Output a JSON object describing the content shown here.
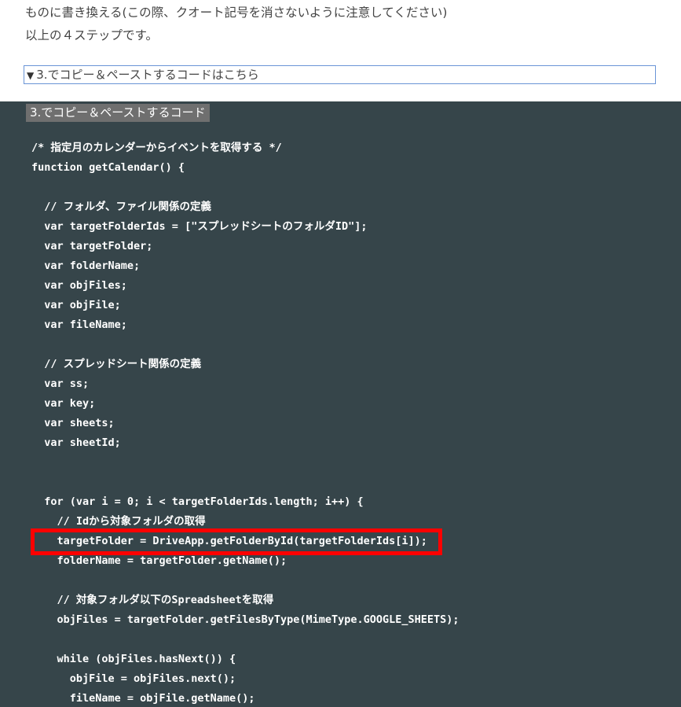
{
  "intro": {
    "line1": "ものに書き換える(この際、クオート記号を消さないように注意してください)",
    "line2": "以上の４ステップです。"
  },
  "details": {
    "arrow": "▼",
    "summary": "3.でコピー＆ペーストするコードはこちら"
  },
  "code_block": {
    "title": "3.でコピー＆ペーストするコード",
    "lines": [
      "/* 指定月のカレンダーからイベントを取得する */",
      "function getCalendar() {",
      "",
      "  // フォルダ、ファイル関係の定義",
      "  var targetFolderIds = [\"スプレッドシートのフォルダID\"];",
      "  var targetFolder;",
      "  var folderName;",
      "  var objFiles;",
      "  var objFile;",
      "  var fileName;",
      "",
      "  // スプレッドシート関係の定義",
      "  var ss;",
      "  var key;",
      "  var sheets;",
      "  var sheetId;",
      "",
      "",
      "  for (var i = 0; i < targetFolderIds.length; i++) {",
      "    // Idから対象フォルダの取得",
      "    targetFolder = DriveApp.getFolderById(targetFolderIds[i]);",
      "    folderName = targetFolder.getName();",
      "",
      "    // 対象フォルダ以下のSpreadsheetを取得",
      "    objFiles = targetFolder.getFilesByType(MimeType.GOOGLE_SHEETS);",
      "",
      "    while (objFiles.hasNext()) {",
      "      objFile = objFiles.next();",
      "      fileName = objFile.getName();"
    ]
  },
  "colors": {
    "code_background": "#36454a",
    "title_badge": "#6f6f6f",
    "highlight_border": "#ff0000",
    "details_border": "#6a95d6"
  }
}
